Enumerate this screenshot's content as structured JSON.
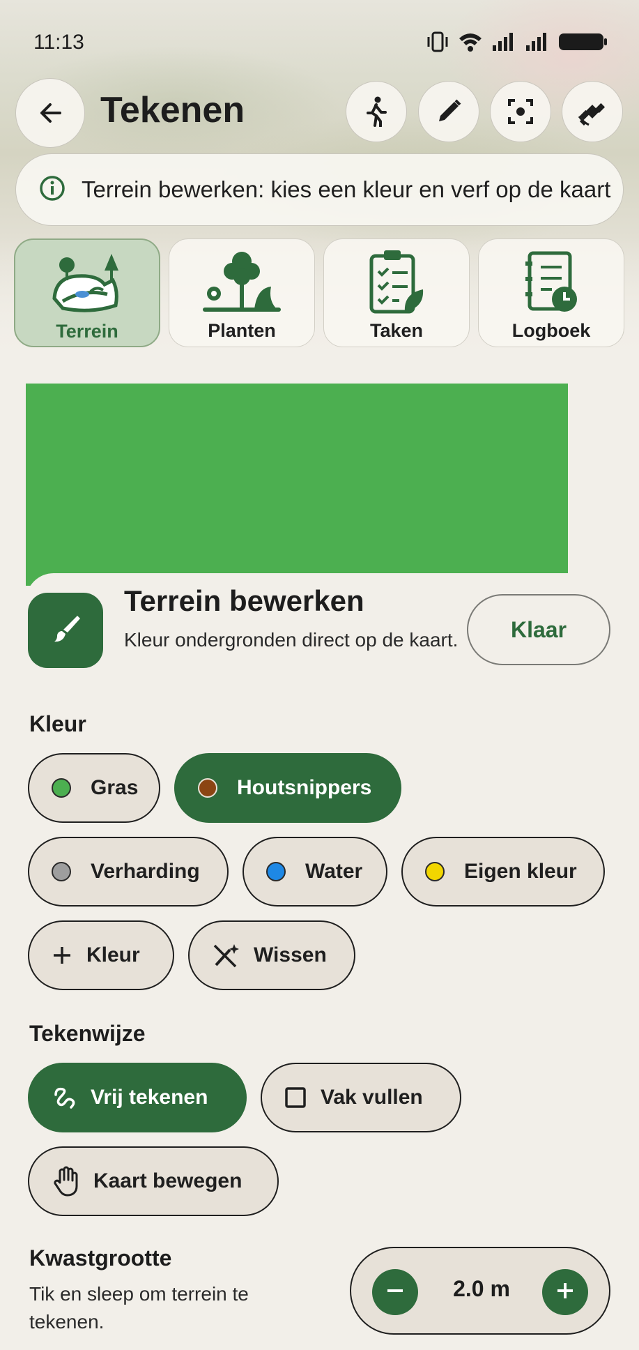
{
  "status_bar": {
    "time": "11:13"
  },
  "header": {
    "title": "Tekenen",
    "tools": [
      "walk-icon",
      "pencil-icon",
      "focus-icon",
      "satellite-icon"
    ]
  },
  "info_banner": {
    "text": "Terrein bewerken: kies een kleur en verf op de kaart"
  },
  "categories": [
    {
      "label": "Terrein",
      "icon": "terrain-icon",
      "active": true
    },
    {
      "label": "Planten",
      "icon": "plants-icon",
      "active": false
    },
    {
      "label": "Taken",
      "icon": "tasks-icon",
      "active": false
    },
    {
      "label": "Logboek",
      "icon": "logbook-icon",
      "active": false
    }
  ],
  "map": {
    "fill_color": "#4caf50"
  },
  "editor": {
    "title": "Terrein bewerken",
    "subtitle": "Kleur ondergronden direct op de kaart.",
    "done_label": "Klaar",
    "color_section": "Kleur",
    "colors": [
      {
        "label": "Gras",
        "color": "#4caf50",
        "selected": false
      },
      {
        "label": "Houtsnippers",
        "color": "#8b4513",
        "selected": true
      },
      {
        "label": "Verharding",
        "color": "#9e9e9e",
        "selected": false
      },
      {
        "label": "Water",
        "color": "#1e88e5",
        "selected": false
      },
      {
        "label": "Eigen kleur",
        "color": "#f2d600",
        "selected": false
      }
    ],
    "add_color_label": "Kleur",
    "erase_label": "Wissen",
    "mode_section": "Tekenwijze",
    "modes": [
      {
        "label": "Vrij tekenen",
        "icon": "freehand-icon",
        "selected": true
      },
      {
        "label": "Vak vullen",
        "icon": "square-icon",
        "selected": false
      },
      {
        "label": "Kaart bewegen",
        "icon": "hand-icon",
        "selected": false
      }
    ],
    "brush": {
      "title": "Kwastgrootte",
      "description": "Tik en sleep om terrein te tekenen.",
      "value": "2.0 m"
    }
  },
  "theme": {
    "primary": "#2e6b3c",
    "chip_bg": "#e7e1d8",
    "background": "#f2efe9"
  }
}
